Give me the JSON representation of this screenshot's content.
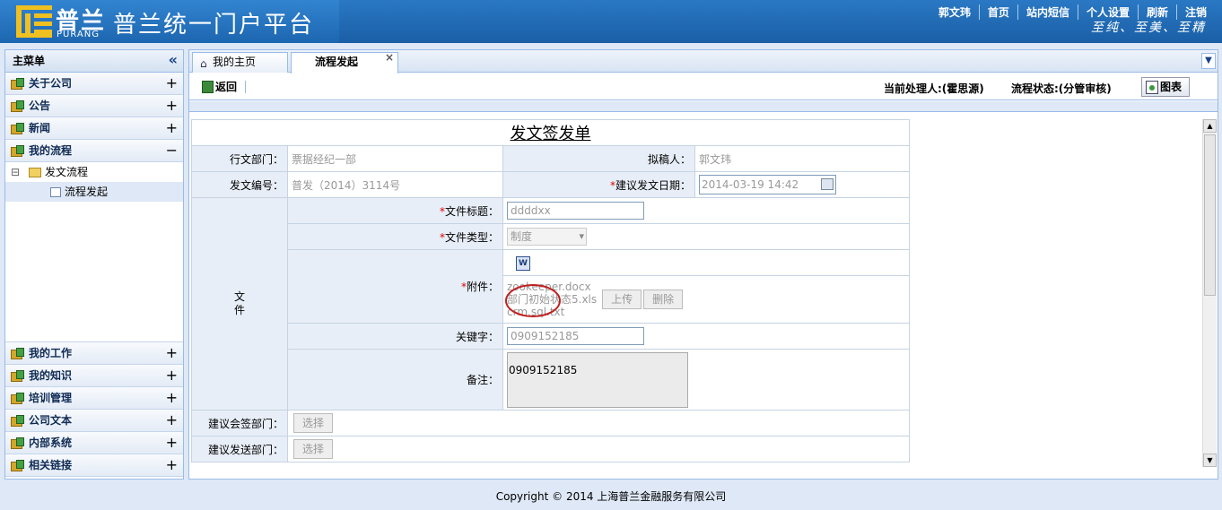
{
  "header": {
    "logo_cn": "普兰",
    "logo_en": "PURANG",
    "title": "普兰统一门户平台",
    "nav": [
      "郭文玮",
      "首页",
      "站内短信",
      "个人设置",
      "刷新",
      "注销"
    ],
    "slogan": "至纯、至美、至精"
  },
  "sidebar": {
    "title": "主菜单",
    "items_top": [
      {
        "label": "关于公司",
        "toggle": "+"
      },
      {
        "label": "公告",
        "toggle": "+"
      },
      {
        "label": "新闻",
        "toggle": "+"
      },
      {
        "label": "我的流程",
        "toggle": "−"
      }
    ],
    "tree": {
      "folder_toggle": "⊟",
      "folder": "发文流程",
      "leaf": "流程发起"
    },
    "items_bottom": [
      {
        "label": "我的工作",
        "toggle": "+"
      },
      {
        "label": "我的知识",
        "toggle": "+"
      },
      {
        "label": "培训管理",
        "toggle": "+"
      },
      {
        "label": "公司文本",
        "toggle": "+"
      },
      {
        "label": "内部系统",
        "toggle": "+"
      },
      {
        "label": "相关链接",
        "toggle": "+"
      }
    ]
  },
  "tabs": [
    {
      "label": "我的主页",
      "active": false
    },
    {
      "label": "流程发起",
      "active": true
    }
  ],
  "toolbar": {
    "back": "返回",
    "handler": "当前处理人:(霍思源)",
    "status": "流程状态:(分管审核)",
    "chart": "图表"
  },
  "form": {
    "title": "发文签发单",
    "dept_label": "行文部门：",
    "dept_value": "票据经纪一部",
    "drafter_label": "拟稿人：",
    "drafter_value": "郭文玮",
    "docno_label": "发文编号：",
    "docno_value": "普发（2014）3114号",
    "date_label": "建议发文日期：",
    "date_value": "2014-03-19 14:42",
    "section_label": "文件",
    "doc_title_label": "文件标题：",
    "doc_title_value": "ddddxx",
    "doc_type_label": "文件类型：",
    "doc_type_value": "制度",
    "attach_label": "附件：",
    "attachments": [
      "zookeeper.docx",
      "部门初始状态5.xls",
      "crm.sql.txt"
    ],
    "upload": "上传",
    "delete": "删除",
    "keyword_label": "关键字：",
    "keyword_value": "0909152185",
    "remark_label": "备注：",
    "remark_value": "0909152185",
    "cosign_label": "建议会签部门：",
    "send_label": "建议发送部门：",
    "select": "选择",
    "req_mark": "*"
  },
  "footer": "Copyright © 2014 上海普兰金融服务有限公司"
}
